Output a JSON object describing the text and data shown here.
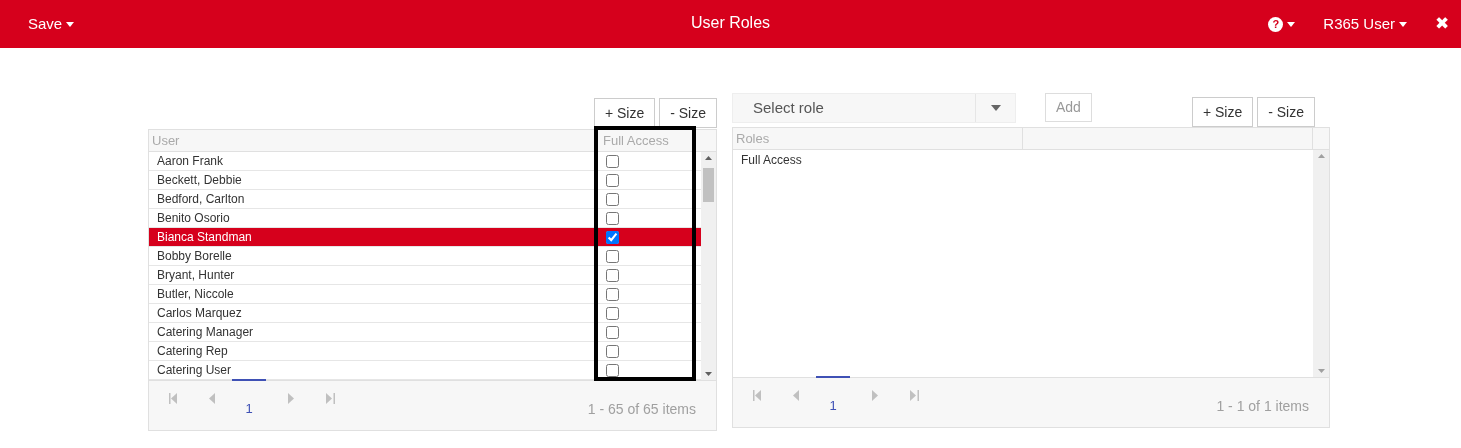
{
  "header": {
    "save_menu": "Save",
    "title": "User Roles",
    "help_menu": "?",
    "user_menu": "R365 User",
    "close": "✖"
  },
  "users_grid": {
    "size_buttons": [
      "+ Size",
      "- Size"
    ],
    "columns": [
      "User",
      "Full Access"
    ],
    "rows": [
      {
        "name": "Aaron Frank",
        "full_access": false,
        "selected": false
      },
      {
        "name": "Beckett, Debbie",
        "full_access": false,
        "selected": false
      },
      {
        "name": "Bedford, Carlton",
        "full_access": false,
        "selected": false
      },
      {
        "name": "Benito Osorio",
        "full_access": false,
        "selected": false
      },
      {
        "name": "Bianca Standman",
        "full_access": true,
        "selected": true
      },
      {
        "name": "Bobby Borelle",
        "full_access": false,
        "selected": false
      },
      {
        "name": "Bryant, Hunter",
        "full_access": false,
        "selected": false
      },
      {
        "name": "Butler, Niccole",
        "full_access": false,
        "selected": false
      },
      {
        "name": "Carlos Marquez",
        "full_access": false,
        "selected": false
      },
      {
        "name": "Catering Manager",
        "full_access": false,
        "selected": false
      },
      {
        "name": "Catering Rep",
        "full_access": false,
        "selected": false
      },
      {
        "name": "Catering User",
        "full_access": false,
        "selected": false
      }
    ],
    "pager": {
      "page": "1",
      "summary": "1 - 65 of 65 items"
    }
  },
  "roles_grid": {
    "select": {
      "placeholder": "Select role"
    },
    "add_button": "Add",
    "size_buttons": [
      "+ Size",
      "- Size"
    ],
    "columns": [
      "Roles"
    ],
    "rows": [
      {
        "name": "Full Access"
      }
    ],
    "pager": {
      "page": "1",
      "summary": "1 - 1 of 1 items"
    }
  }
}
